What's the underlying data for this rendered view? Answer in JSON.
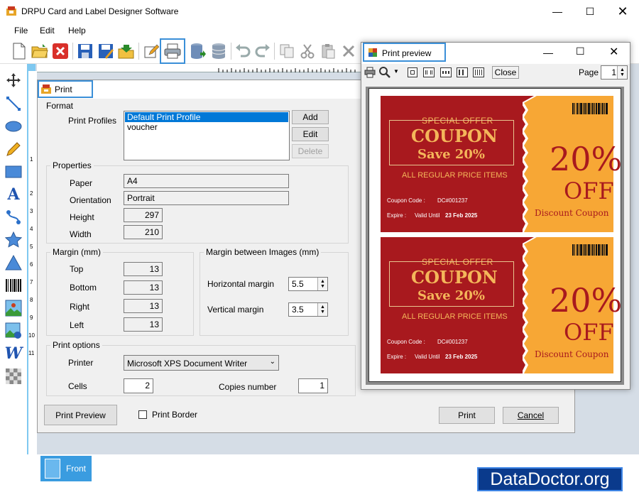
{
  "window": {
    "title": "DRPU Card and Label Designer Software"
  },
  "menu": {
    "file": "File",
    "edit": "Edit",
    "help": "Help"
  },
  "print_dialog": {
    "title": "Print",
    "format_label": "Format",
    "print_profiles_label": "Print Profiles",
    "profiles": [
      "Default Print Profile",
      "voucher"
    ],
    "add_label": "Add",
    "edit_label": "Edit",
    "delete_label": "Delete",
    "properties_label": "Properties",
    "paper_label": "Paper",
    "paper_value": "A4",
    "orientation_label": "Orientation",
    "orientation_value": "Portrait",
    "height_label": "Height",
    "height_value": "297",
    "width_label": "Width",
    "width_value": "210",
    "margin_label": "Margin (mm)",
    "top_label": "Top",
    "top_value": "13",
    "bottom_label": "Bottom",
    "bottom_value": "13",
    "right_label": "Right",
    "right_value": "13",
    "left_label": "Left",
    "left_value": "13",
    "margin_images_label": "Margin between Images (mm)",
    "horizontal_margin_label": "Horizontal margin",
    "horizontal_margin_value": "5.5",
    "vertical_margin_label": "Vertical margin",
    "vertical_margin_value": "3.5",
    "print_options_label": "Print options",
    "printer_label": "Printer",
    "printer_value": "Microsoft XPS Document Writer",
    "cells_label": "Cells",
    "cells_value": "2",
    "copies_label": "Copies number",
    "copies_value": "1",
    "print_preview_label": "Print Preview",
    "print_border_label": "Print Border",
    "print_label": "Print",
    "cancel_label": "Cancel"
  },
  "preview": {
    "title": "Print preview",
    "close_label": "Close",
    "page_label": "Page",
    "page_value": "1"
  },
  "coupon": {
    "special_offer": "SPECIAL OFFER",
    "coupon_word": "COUPON",
    "save": "Save 20%",
    "all_items": "ALL REGULAR PRICE ITEMS",
    "code_label": "Coupon Code :",
    "code_value": "DC#001237",
    "expire_label": "Expire :",
    "expire_value": "Valid Until",
    "expire_date": "23 Feb 2025",
    "pct": "20%",
    "off": "OFF",
    "discount": "Discount Coupon"
  },
  "bottom": {
    "front_tab": "Front",
    "watermark": "DataDoctor.org"
  },
  "ruler": {
    "left_numbers": [
      "1",
      "2",
      "3",
      "4",
      "5",
      "6",
      "7",
      "8",
      "9",
      "10",
      "11"
    ]
  },
  "colors": {
    "accent": "#3a8fd8",
    "coupon_red": "#a8191e",
    "coupon_orange": "#f7a735",
    "coupon_gold": "#f4b65a"
  }
}
